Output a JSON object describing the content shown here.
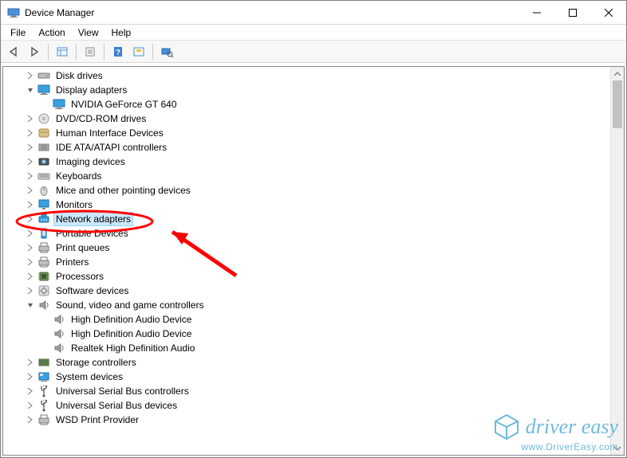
{
  "window": {
    "title": "Device Manager"
  },
  "menu": {
    "items": [
      "File",
      "Action",
      "View",
      "Help"
    ]
  },
  "toolbar": {
    "buttons": [
      "back",
      "forward",
      "show-hidden",
      "properties",
      "help",
      "update",
      "scan-hardware"
    ]
  },
  "tree": {
    "nodes": [
      {
        "label": "Disk drives",
        "depth": 1,
        "expand": "closed",
        "icon": "disk",
        "highlighted": false
      },
      {
        "label": "Display adapters",
        "depth": 1,
        "expand": "open",
        "icon": "display",
        "highlighted": false
      },
      {
        "label": "NVIDIA GeForce GT 640",
        "depth": 2,
        "expand": "none",
        "icon": "display",
        "highlighted": false
      },
      {
        "label": "DVD/CD-ROM drives",
        "depth": 1,
        "expand": "closed",
        "icon": "dvd",
        "highlighted": false
      },
      {
        "label": "Human Interface Devices",
        "depth": 1,
        "expand": "closed",
        "icon": "hid",
        "highlighted": false
      },
      {
        "label": "IDE ATA/ATAPI controllers",
        "depth": 1,
        "expand": "closed",
        "icon": "ide",
        "highlighted": false
      },
      {
        "label": "Imaging devices",
        "depth": 1,
        "expand": "closed",
        "icon": "imaging",
        "highlighted": false
      },
      {
        "label": "Keyboards",
        "depth": 1,
        "expand": "closed",
        "icon": "keyboard",
        "highlighted": false
      },
      {
        "label": "Mice and other pointing devices",
        "depth": 1,
        "expand": "closed",
        "icon": "mouse",
        "highlighted": false
      },
      {
        "label": "Monitors",
        "depth": 1,
        "expand": "closed",
        "icon": "monitor",
        "highlighted": false
      },
      {
        "label": "Network adapters",
        "depth": 1,
        "expand": "closed",
        "icon": "network",
        "highlighted": true
      },
      {
        "label": "Portable Devices",
        "depth": 1,
        "expand": "closed",
        "icon": "portable",
        "highlighted": false
      },
      {
        "label": "Print queues",
        "depth": 1,
        "expand": "closed",
        "icon": "printqueue",
        "highlighted": false
      },
      {
        "label": "Printers",
        "depth": 1,
        "expand": "closed",
        "icon": "printer",
        "highlighted": false
      },
      {
        "label": "Processors",
        "depth": 1,
        "expand": "closed",
        "icon": "cpu",
        "highlighted": false
      },
      {
        "label": "Software devices",
        "depth": 1,
        "expand": "closed",
        "icon": "software",
        "highlighted": false
      },
      {
        "label": "Sound, video and game controllers",
        "depth": 1,
        "expand": "open",
        "icon": "sound",
        "highlighted": false
      },
      {
        "label": "High Definition Audio Device",
        "depth": 2,
        "expand": "none",
        "icon": "sound",
        "highlighted": false
      },
      {
        "label": "High Definition Audio Device",
        "depth": 2,
        "expand": "none",
        "icon": "sound",
        "highlighted": false
      },
      {
        "label": "Realtek High Definition Audio",
        "depth": 2,
        "expand": "none",
        "icon": "sound",
        "highlighted": false
      },
      {
        "label": "Storage controllers",
        "depth": 1,
        "expand": "closed",
        "icon": "storage",
        "highlighted": false
      },
      {
        "label": "System devices",
        "depth": 1,
        "expand": "closed",
        "icon": "system",
        "highlighted": false
      },
      {
        "label": "Universal Serial Bus controllers",
        "depth": 1,
        "expand": "closed",
        "icon": "usb",
        "highlighted": false
      },
      {
        "label": "Universal Serial Bus devices",
        "depth": 1,
        "expand": "closed",
        "icon": "usb",
        "highlighted": false
      },
      {
        "label": "WSD Print Provider",
        "depth": 1,
        "expand": "closed",
        "icon": "printqueue",
        "highlighted": false
      }
    ]
  },
  "annotation": {
    "circled_item": "Network adapters",
    "arrow_color": "#ff0000"
  },
  "watermark": {
    "brand_html": "driver easy",
    "url": "www.DriverEasy.com"
  }
}
